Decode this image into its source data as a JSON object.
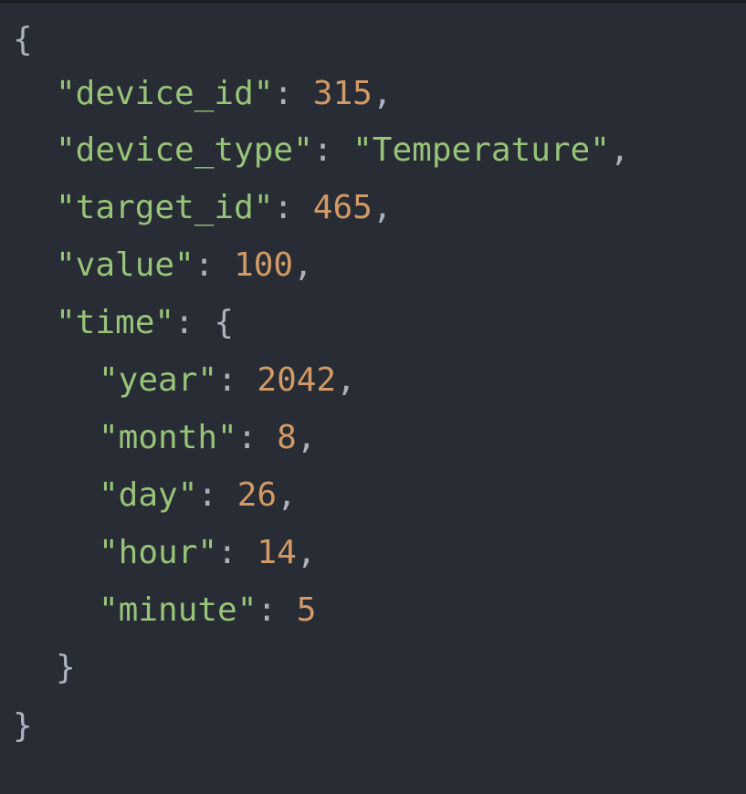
{
  "colors": {
    "background": "#282c34",
    "key": "#98c379",
    "string": "#98c379",
    "number": "#d19a66",
    "punctuation": "#abb2bf"
  },
  "code": {
    "open_brace": "{",
    "close_brace": "}",
    "device_id_key": "\"device_id\"",
    "device_id_value": "315",
    "device_type_key": "\"device_type\"",
    "device_type_value": "\"Temperature\"",
    "target_id_key": "\"target_id\"",
    "target_id_value": "465",
    "value_key": "\"value\"",
    "value_value": "100",
    "time_key": "\"time\"",
    "time": {
      "open_brace": "{",
      "close_brace": "}",
      "year_key": "\"year\"",
      "year_value": "2042",
      "month_key": "\"month\"",
      "month_value": "8",
      "day_key": "\"day\"",
      "day_value": "26",
      "hour_key": "\"hour\"",
      "hour_value": "14",
      "minute_key": "\"minute\"",
      "minute_value": "5"
    }
  }
}
